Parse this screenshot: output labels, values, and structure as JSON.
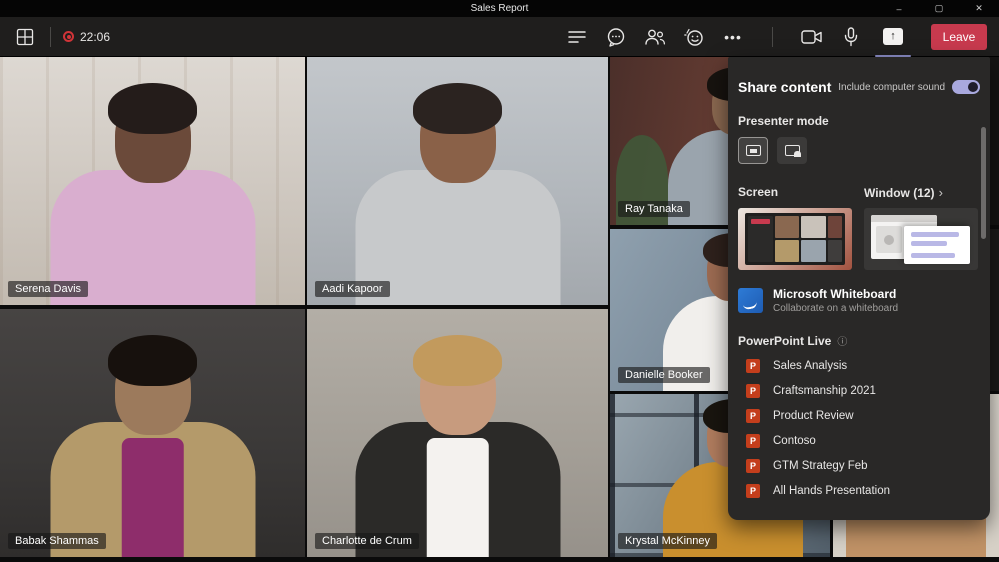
{
  "window": {
    "title": "Sales Report"
  },
  "toolbar": {
    "timer": "22:06",
    "leave_label": "Leave"
  },
  "icons": {
    "minimize": "–",
    "maximize": "▢",
    "close": "✕",
    "more": "•••",
    "arrow_up": "↑",
    "chevron": "›",
    "info": "ⓘ",
    "ppt_letter": "P"
  },
  "participants": [
    {
      "name": "Serena Davis"
    },
    {
      "name": "Aadi Kapoor"
    },
    {
      "name": "Ray Tanaka"
    },
    {
      "name": "Danielle Booker"
    },
    {
      "name": "Babak Shammas"
    },
    {
      "name": "Charlotte de Crum"
    },
    {
      "name": "Krystal McKinney"
    }
  ],
  "share_panel": {
    "title": "Share content",
    "include_sound_label": "Include computer sound",
    "include_sound_on": true,
    "presenter_mode_label": "Presenter mode",
    "screen_label": "Screen",
    "window_label": "Window (12)",
    "whiteboard_title": "Microsoft Whiteboard",
    "whiteboard_subtitle": "Collaborate on a whiteboard",
    "powerpoint_live_label": "PowerPoint Live",
    "presentations": [
      "Sales Analysis",
      "Craftsmanship 2021",
      "Product Review",
      "Contoso",
      "GTM Strategy Feb",
      "All Hands Presentation"
    ]
  },
  "colors": {
    "accent_lavender": "#a9a9de",
    "leave_red": "#c83a4e",
    "record_red": "#d13438",
    "whiteboard_blue": "#2e7bd6",
    "powerpoint_red": "#c43e1c"
  }
}
